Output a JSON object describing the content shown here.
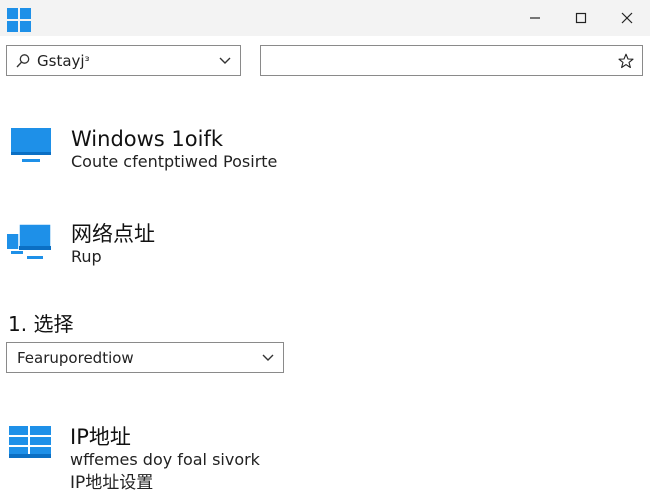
{
  "titlebar": {
    "icons": [
      "windows-logo-icon",
      "minimize-icon",
      "maximize-icon",
      "close-icon"
    ]
  },
  "search": {
    "value": "Gstayjᵌ"
  },
  "address": {
    "value": "",
    "icon": "star-icon"
  },
  "entries": [
    {
      "icon": "monitor-icon",
      "title": "Windows 1oifk",
      "subtitle": "Coute cfentptiwed Posirte"
    },
    {
      "icon": "network-monitor-icon",
      "title": "网络点址",
      "subtitle": "Rup"
    }
  ],
  "section": {
    "label": "1. 选择"
  },
  "feature_select": {
    "value": "Fearuporedtiow"
  },
  "ip_entry": {
    "icon": "grid-monitor-icon",
    "title": "IP地址",
    "subtitle": "wffemes doy foal sivork",
    "subtitle2": "IP地址设置"
  },
  "colors": {
    "accent": "#1e90e8",
    "accent_dark": "#0b6fc4",
    "titlebar_bg": "#f3f3f3",
    "border": "#8a8a8a"
  }
}
